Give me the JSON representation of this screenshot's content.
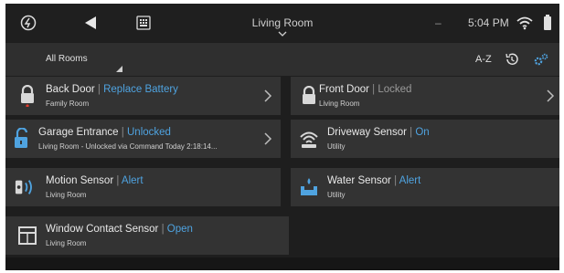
{
  "status_bar": {
    "room_title": "Living Room",
    "dash": "–",
    "time": "5:04 PM",
    "icons": [
      "home-logo-icon",
      "back-arrow-icon",
      "keypad-icon",
      "wifi-icon",
      "battery-icon"
    ]
  },
  "toolbar": {
    "filter_label": "All Rooms",
    "sort_label": "A-Z",
    "icons": [
      "history-icon",
      "settings-icon"
    ]
  },
  "devices": [
    {
      "name": "Back Door",
      "status": "Replace Battery",
      "room": "Family Room",
      "icon": "lock-icon",
      "status_color": "#4fa3e0"
    },
    {
      "name": "Front Door",
      "status": "Locked",
      "room": "Living Room",
      "icon": "lock-icon",
      "status_color": "#9a9a9a"
    },
    {
      "name": "Garage Entrance",
      "status": "Unlocked",
      "room": "Living Room - Unlocked via Command Today 2:18:14...",
      "icon": "unlock-icon",
      "status_color": "#4fa3e0"
    },
    {
      "name": "Driveway Sensor",
      "status": "On",
      "room": "Utility",
      "icon": "motion-sensor-icon",
      "status_color": "#4fa3e0"
    },
    {
      "name": "Motion Sensor",
      "status": "Alert",
      "room": "Living Room",
      "icon": "wave-sensor-icon",
      "status_color": "#4fa3e0"
    },
    {
      "name": "Water Sensor",
      "status": "Alert",
      "room": "Utility",
      "icon": "water-sensor-icon",
      "status_color": "#4fa3e0"
    },
    {
      "name": "Window Contact Sensor",
      "status": "Open",
      "room": "Living Room",
      "icon": "window-icon",
      "status_color": "#4fa3e0"
    }
  ],
  "separator": "|",
  "colors": {
    "accent": "#4fa3e0",
    "card": "#333333",
    "background": "#1e1e1e",
    "alert_dot": "#e53b2c"
  }
}
